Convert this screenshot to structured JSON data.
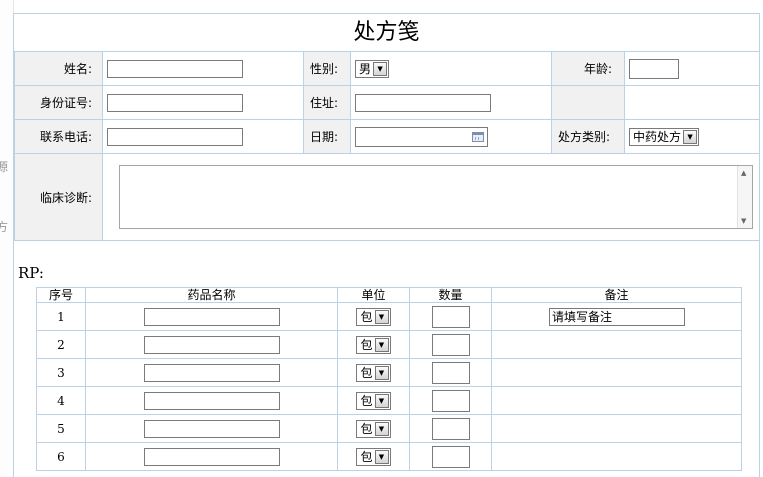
{
  "sidebar": {
    "glyphs": [
      "源",
      "方"
    ]
  },
  "form": {
    "title": "处方笺",
    "name_label": "姓名:",
    "gender_label": "性别:",
    "gender_value": "男",
    "age_label": "年龄:",
    "idcard_label": "身份证号:",
    "address_label": "住址:",
    "phone_label": "联系电话:",
    "date_label": "日期:",
    "rx_type_label": "处方类别:",
    "rx_type_value": "中药处方",
    "diagnosis_label": "临床诊断:"
  },
  "rp": {
    "label": "RP:",
    "headers": {
      "seq": "序号",
      "drug_name": "药品名称",
      "unit": "单位",
      "qty": "数量",
      "remark": "备注"
    },
    "rows": [
      {
        "seq": "1",
        "unit": "包",
        "remark": "请填写备注"
      },
      {
        "seq": "2",
        "unit": "包"
      },
      {
        "seq": "3",
        "unit": "包"
      },
      {
        "seq": "4",
        "unit": "包"
      },
      {
        "seq": "5",
        "unit": "包"
      },
      {
        "seq": "6",
        "unit": "包"
      }
    ]
  }
}
